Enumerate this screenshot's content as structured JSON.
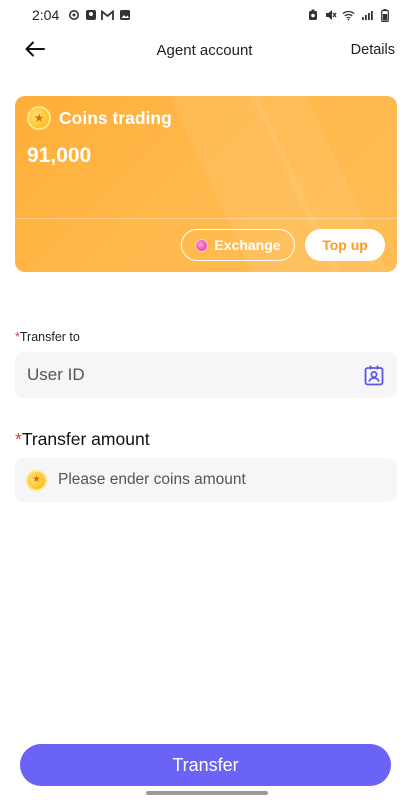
{
  "status_bar": {
    "time": "2:04",
    "left_icons": [
      "settings-icon",
      "contact-icon",
      "gmail-icon",
      "image-icon"
    ],
    "right_icons": [
      "alarm-icon",
      "mute-icon",
      "wifi-icon",
      "signal-icon",
      "battery-icon"
    ]
  },
  "header": {
    "title": "Agent account",
    "details_label": "Details"
  },
  "coin_card": {
    "title": "Coins trading",
    "balance": "91,000",
    "exchange_label": "Exchange",
    "topup_label": "Top up",
    "colors": {
      "card": "#ffb444",
      "topup_text": "#ff9b1a"
    }
  },
  "form": {
    "transfer_to_label": "Transfer to",
    "transfer_to_required": "*",
    "user_id_placeholder": "User ID",
    "amount_label": "Transfer amount",
    "amount_required": "*",
    "amount_placeholder": "Please ender coins amount"
  },
  "transfer_button": {
    "label": "Transfer",
    "color": "#6a63f5"
  }
}
